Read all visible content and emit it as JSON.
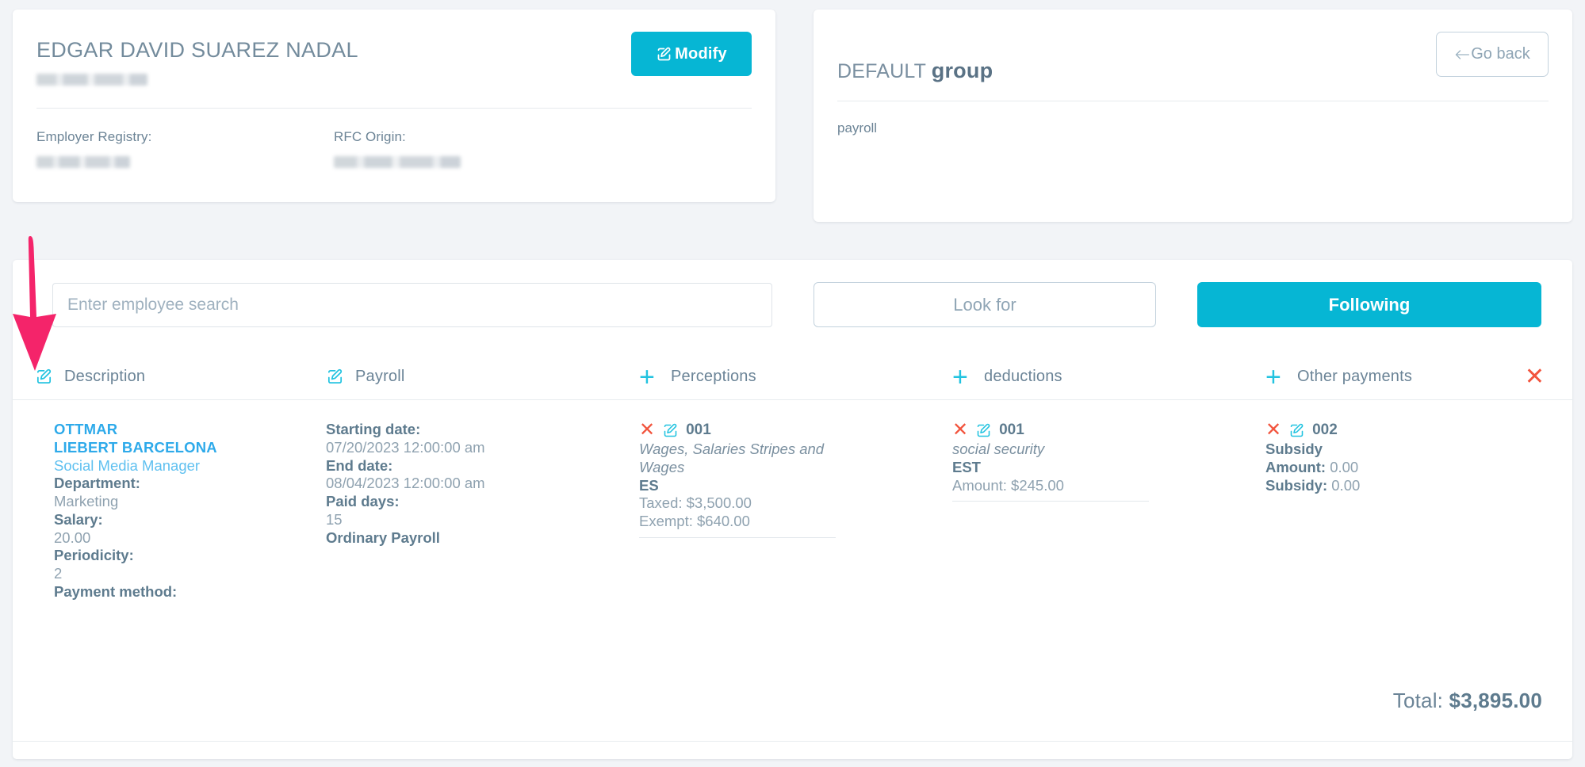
{
  "employee_card": {
    "name": "EDGAR DAVID SUAREZ NADAL",
    "subtitle_redacted": "",
    "modify_button": "Modify",
    "modify_icon": "edit-pencil-icon",
    "fields": [
      {
        "label": "Employer Registry:",
        "value_redacted": ""
      },
      {
        "label": "RFC Origin:",
        "value_redacted": ""
      }
    ]
  },
  "group_card": {
    "title_prefix": "DEFAULT",
    "title_strong": "group",
    "go_back_button": "Go back",
    "go_back_icon": "arrow-left-icon",
    "body": "payroll"
  },
  "toolbar": {
    "search_placeholder": "Enter employee search",
    "search_value": "",
    "look_for_button": "Look for",
    "following_button": "Following"
  },
  "columns": [
    {
      "label": "Description",
      "icon": "edit-pencil-icon"
    },
    {
      "label": "Payroll",
      "icon": "edit-pencil-icon"
    },
    {
      "label": "Perceptions",
      "icon": "plus-icon"
    },
    {
      "label": "deductions",
      "icon": "plus-icon"
    },
    {
      "label": "Other payments",
      "icon": "plus-icon"
    }
  ],
  "row_close_icon": "close-x-icon",
  "description": {
    "name_line1": "OTTMAR",
    "name_line2": "LIEBERT BARCELONA",
    "role": "Social Media Manager",
    "department_label": "Department:",
    "department_value": "Marketing",
    "salary_label": "Salary:",
    "salary_value": "20.00",
    "periodicity_label": "Periodicity:",
    "periodicity_value": "2",
    "payment_method_label": "Payment method:",
    "payment_method_value": ""
  },
  "payroll": {
    "start_label": "Starting date:",
    "start_value": "07/20/2023 12:00:00 am",
    "end_label": "End date:",
    "end_value": "08/04/2023 12:00:00 am",
    "paid_days_label": "Paid days:",
    "paid_days_value": "15",
    "type": "Ordinary Payroll"
  },
  "perceptions": [
    {
      "code": "001",
      "concept": "Wages, Salaries Stripes and Wages",
      "type": "ES",
      "taxed": "Taxed: $3,500.00",
      "exempt": "Exempt: $640.00"
    }
  ],
  "deductions": [
    {
      "code": "001",
      "concept": "social security",
      "type": "EST",
      "amount": "Amount: $245.00"
    }
  ],
  "other_payments": [
    {
      "code": "002",
      "concept": "Subsidy",
      "amount_label": "Amount:",
      "amount_value": "0.00",
      "subsidy_label": "Subsidy:",
      "subsidy_value": "0.00"
    }
  ],
  "total": {
    "label": "Total:",
    "value": "$3,895.00"
  },
  "annotation": {
    "type": "down-arrow",
    "color": "#f4246a"
  },
  "colors": {
    "accent_cyan": "#06b6d4",
    "icon_cyan": "#22c3e0",
    "danger_red": "#f2543d",
    "text_slate": "#6b8497",
    "link_blue": "#2eaaea",
    "annotation_pink": "#f4246a",
    "page_bg": "#f2f4f7"
  }
}
